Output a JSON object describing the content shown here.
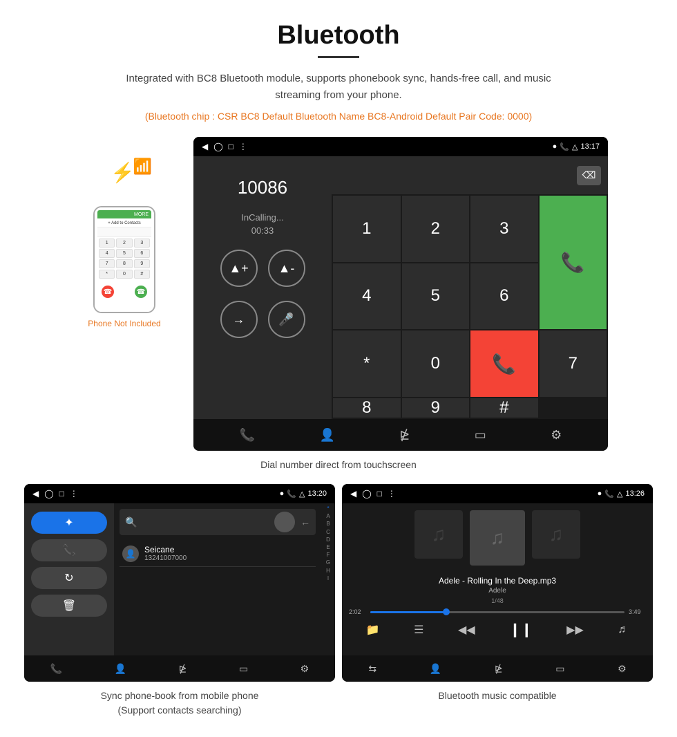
{
  "page": {
    "title": "Bluetooth",
    "subtitle": "Integrated with BC8 Bluetooth module, supports phonebook sync, hands-free call, and music streaming from your phone.",
    "orange_info": "(Bluetooth chip : CSR BC8    Default Bluetooth Name BC8-Android    Default Pair Code: 0000)",
    "dial_caption": "Dial number direct from touchscreen",
    "phonebook_caption_line1": "Sync phone-book from mobile phone",
    "phonebook_caption_line2": "(Support contacts searching)",
    "music_caption": "Bluetooth music compatible"
  },
  "dial_screen": {
    "status_time": "13:17",
    "phone_number": "10086",
    "incalling": "InCalling...",
    "timer": "00:33",
    "keys": [
      "1",
      "2",
      "3",
      "*",
      "4",
      "5",
      "6",
      "0",
      "7",
      "8",
      "9",
      "#"
    ],
    "green_key": "📞",
    "red_key": "📞"
  },
  "phonebook_screen": {
    "status_time": "13:20",
    "contact_name": "Seicane",
    "contact_number": "13241007000",
    "alpha_list": [
      "*",
      "A",
      "B",
      "C",
      "D",
      "E",
      "F",
      "G",
      "H",
      "I"
    ]
  },
  "music_screen": {
    "status_time": "13:26",
    "song_title": "Adele - Rolling In the Deep.mp3",
    "artist": "Adele",
    "track_info": "1/48",
    "time_current": "2:02",
    "time_total": "3:49"
  },
  "phone_illustration": {
    "not_included": "Phone Not Included",
    "keys": [
      "1",
      "2",
      "3",
      "4",
      "5",
      "6",
      "7",
      "8",
      "9",
      "*",
      "0",
      "#"
    ]
  }
}
